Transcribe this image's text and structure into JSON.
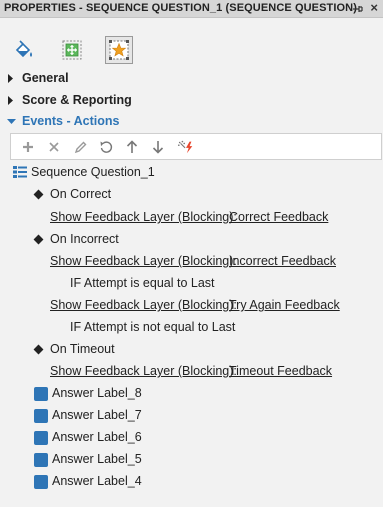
{
  "window": {
    "title": "PROPERTIES - SEQUENCE QUESTION_1 (SEQUENCE QUESTION)",
    "pin_icon": "pin-icon",
    "close_icon": "close-icon",
    "close_glyph": "×"
  },
  "tabs": [
    {
      "icon": "paint-bucket-icon"
    },
    {
      "icon": "move-arrows-icon"
    },
    {
      "icon": "star-action-icon",
      "selected": true
    }
  ],
  "sections": {
    "general": "General",
    "score": "Score & Reporting",
    "events": "Events - Actions"
  },
  "toolbar": {
    "buttons": [
      "add-icon",
      "delete-icon",
      "edit-icon",
      "undo-icon",
      "move-up-icon",
      "move-down-icon",
      "magic-icon"
    ]
  },
  "tree": {
    "root": "Sequence Question_1",
    "on_correct": "On Correct",
    "on_correct_action": "Show Feedback Layer (Blocking):",
    "on_correct_target": "Correct Feedback",
    "on_incorrect": "On Incorrect",
    "on_incorrect_action": "Show Feedback Layer (Blocking):",
    "on_incorrect_target": "Incorrect Feedback",
    "cond1": "IF Attempt is equal to Last",
    "try_action": "Show Feedback Layer (Blocking):",
    "try_target": "Try Again Feedback",
    "cond2": "IF Attempt is not equal to Last",
    "on_timeout": "On Timeout",
    "timeout_action": "Show Feedback Layer (Blocking):",
    "timeout_target": "Timeout Feedback",
    "answers": [
      "Answer Label_8",
      "Answer Label_7",
      "Answer Label_6",
      "Answer Label_5",
      "Answer Label_4"
    ]
  },
  "colors": {
    "accent": "#2e75b6",
    "background": "#f2f2f2",
    "titlebar": "#d6d6d6"
  }
}
